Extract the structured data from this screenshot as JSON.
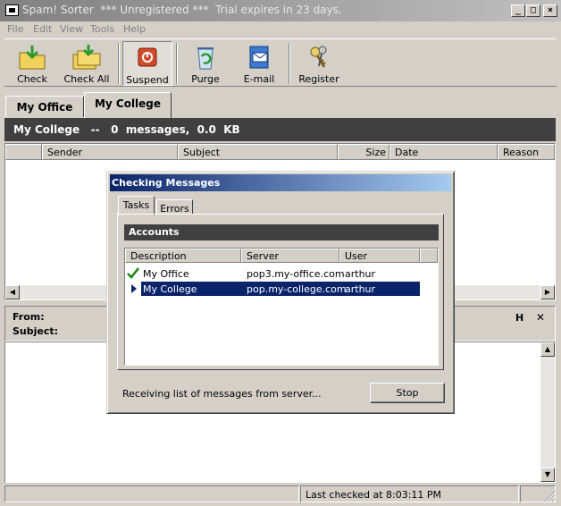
{
  "window": {
    "title": "Spam! Sorter  *** Unregistered ***  Trial expires in 23 days.",
    "minimize_glyph": "_",
    "maximize_glyph": "□",
    "close_glyph": "×"
  },
  "menu": [
    "File",
    "Edit",
    "View",
    "Tools",
    "Help"
  ],
  "toolbar": {
    "check": "Check",
    "check_all": "Check  All",
    "suspend": "Suspend",
    "purge": "Purge",
    "email": "E-mail",
    "register": "Register"
  },
  "tabs": {
    "office": "My Office",
    "college": "My College"
  },
  "folder_header": "My College   --   0  messages,  0.0  KB",
  "message_columns": {
    "sender": "Sender",
    "subject": "Subject",
    "size": "Size",
    "date": "Date",
    "reason": "Reason"
  },
  "preview": {
    "from_label": "From:",
    "subject_label": "Subject:",
    "h_label": "H",
    "close_label": "✕"
  },
  "status": {
    "last_checked": "Last checked at  8:03:11 PM"
  },
  "dialog": {
    "title": "Checking Messages",
    "tab_tasks": "Tasks",
    "tab_errors": "Errors",
    "section": "Accounts",
    "columns": {
      "description": "Description",
      "server": "Server",
      "user": "User"
    },
    "accounts": [
      {
        "description": "My Office",
        "server": "pop3.my-office.com",
        "user": "arthur",
        "state": "done"
      },
      {
        "description": "My College",
        "server": "pop.my-college.com",
        "user": "arthur",
        "state": "active"
      }
    ],
    "progress_text": "Receiving list of messages from server...",
    "stop": "Stop"
  },
  "colors": {
    "dialog_title_start": "#0a246a",
    "dialog_title_end": "#a6caf0",
    "selection": "#0a246a",
    "check_green": "#1a8a1a",
    "suspend_red": "#d24a2a"
  }
}
